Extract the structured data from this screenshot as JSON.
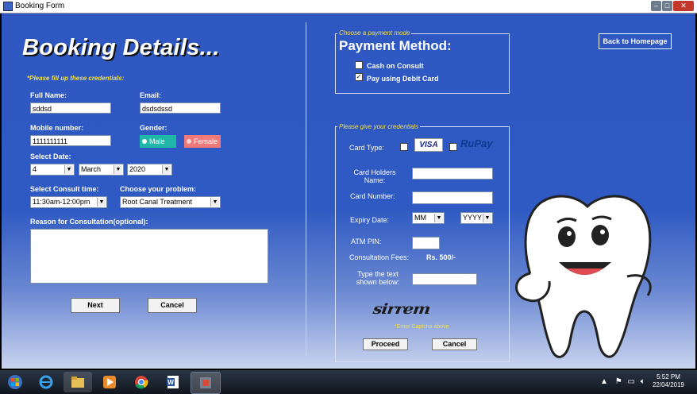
{
  "window": {
    "title": "Booking Form"
  },
  "left": {
    "heading": "Booking Details...",
    "note": "*Please fill up these credentials:",
    "full_name": {
      "label": "Full Name:",
      "value": "sddsd"
    },
    "email": {
      "label": "Email:",
      "value": "dsdsdssd"
    },
    "mobile": {
      "label": "Mobile number:",
      "value": "1111111111"
    },
    "gender": {
      "label": "Gender:",
      "male": "Male",
      "female": "Female"
    },
    "date": {
      "label": "Select Date:",
      "day": "4",
      "month": "March",
      "year": "2020"
    },
    "consult_time": {
      "label": "Select Consult time:",
      "value": "11:30am-12:00pm"
    },
    "problem": {
      "label": "Choose your problem:",
      "value": "Root Canal Treatment"
    },
    "reason": {
      "label": "Reason for Consultation(optional):"
    },
    "next_label": "Next",
    "cancel_label": "Cancel"
  },
  "right": {
    "back_label": "Back to Homepage",
    "payment_group_title": "Choose a payment mode",
    "payment_heading": "Payment Method:",
    "cash_label": "Cash on Consult",
    "debit_label": "Pay using Debit Card",
    "debit_checked": true,
    "cred_group_title": "Please give your credentials",
    "card_type_label": "Card Type:",
    "visa_label": "VISA",
    "rupay_label": "RuPay",
    "holder_label": "Card Holders Name:",
    "number_label": "Card Number:",
    "expiry_label": "Expiry Date:",
    "expiry_month": "MM",
    "expiry_year": "YYYY",
    "pin_label": "ATM PIN:",
    "fees_label": "Consultation Fees:",
    "fees_value": "Rs. 500/-",
    "captcha_prompt": "Type the text shown below:",
    "captcha_text": "sirrem",
    "captcha_note": "*Enter Captcha above",
    "proceed_label": "Proceed",
    "cancel_label": "Cancel"
  },
  "taskbar": {
    "time": "5:52 PM",
    "date": "22/04/2019"
  },
  "colors": {
    "background": "#2f57c2",
    "male": "#1fb8a8",
    "female": "#f07a7a",
    "note": "#f0e04a"
  }
}
